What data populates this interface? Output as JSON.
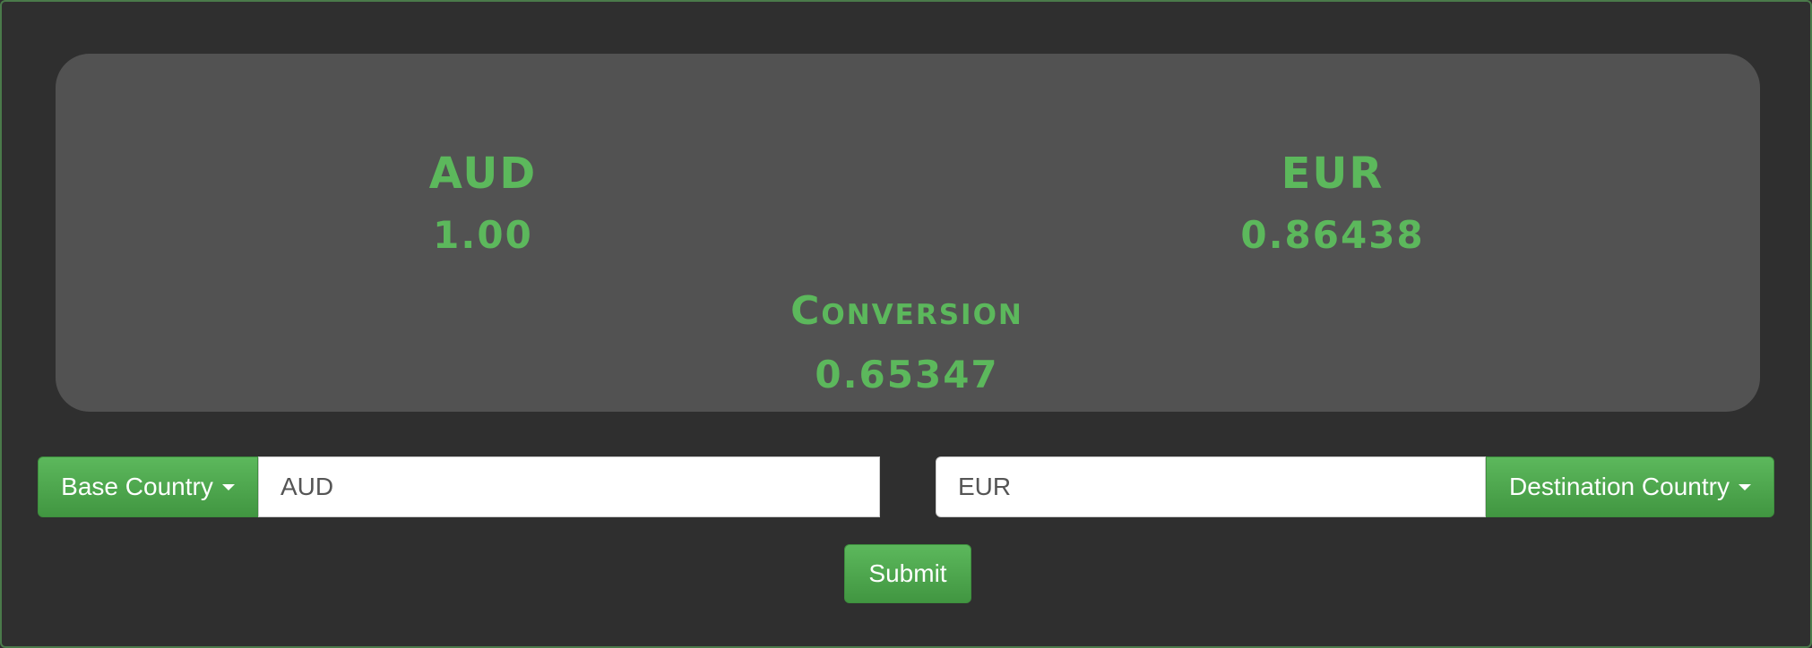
{
  "display": {
    "base_code": "AUD",
    "base_value": "1.00",
    "dest_code": "EUR",
    "dest_value": "0.86438",
    "conversion_title": "Conversion",
    "conversion_value": "0.65347"
  },
  "form": {
    "base_dropdown_label": "Base Country",
    "base_input_value": "AUD",
    "dest_input_value": "EUR",
    "dest_dropdown_label": "Destination Country",
    "submit_label": "Submit"
  },
  "colors": {
    "accent": "#5cb85c",
    "panel": "#525252",
    "background": "#2f2f2f"
  },
  "icons": {
    "dropdown": "caret-down-icon"
  }
}
